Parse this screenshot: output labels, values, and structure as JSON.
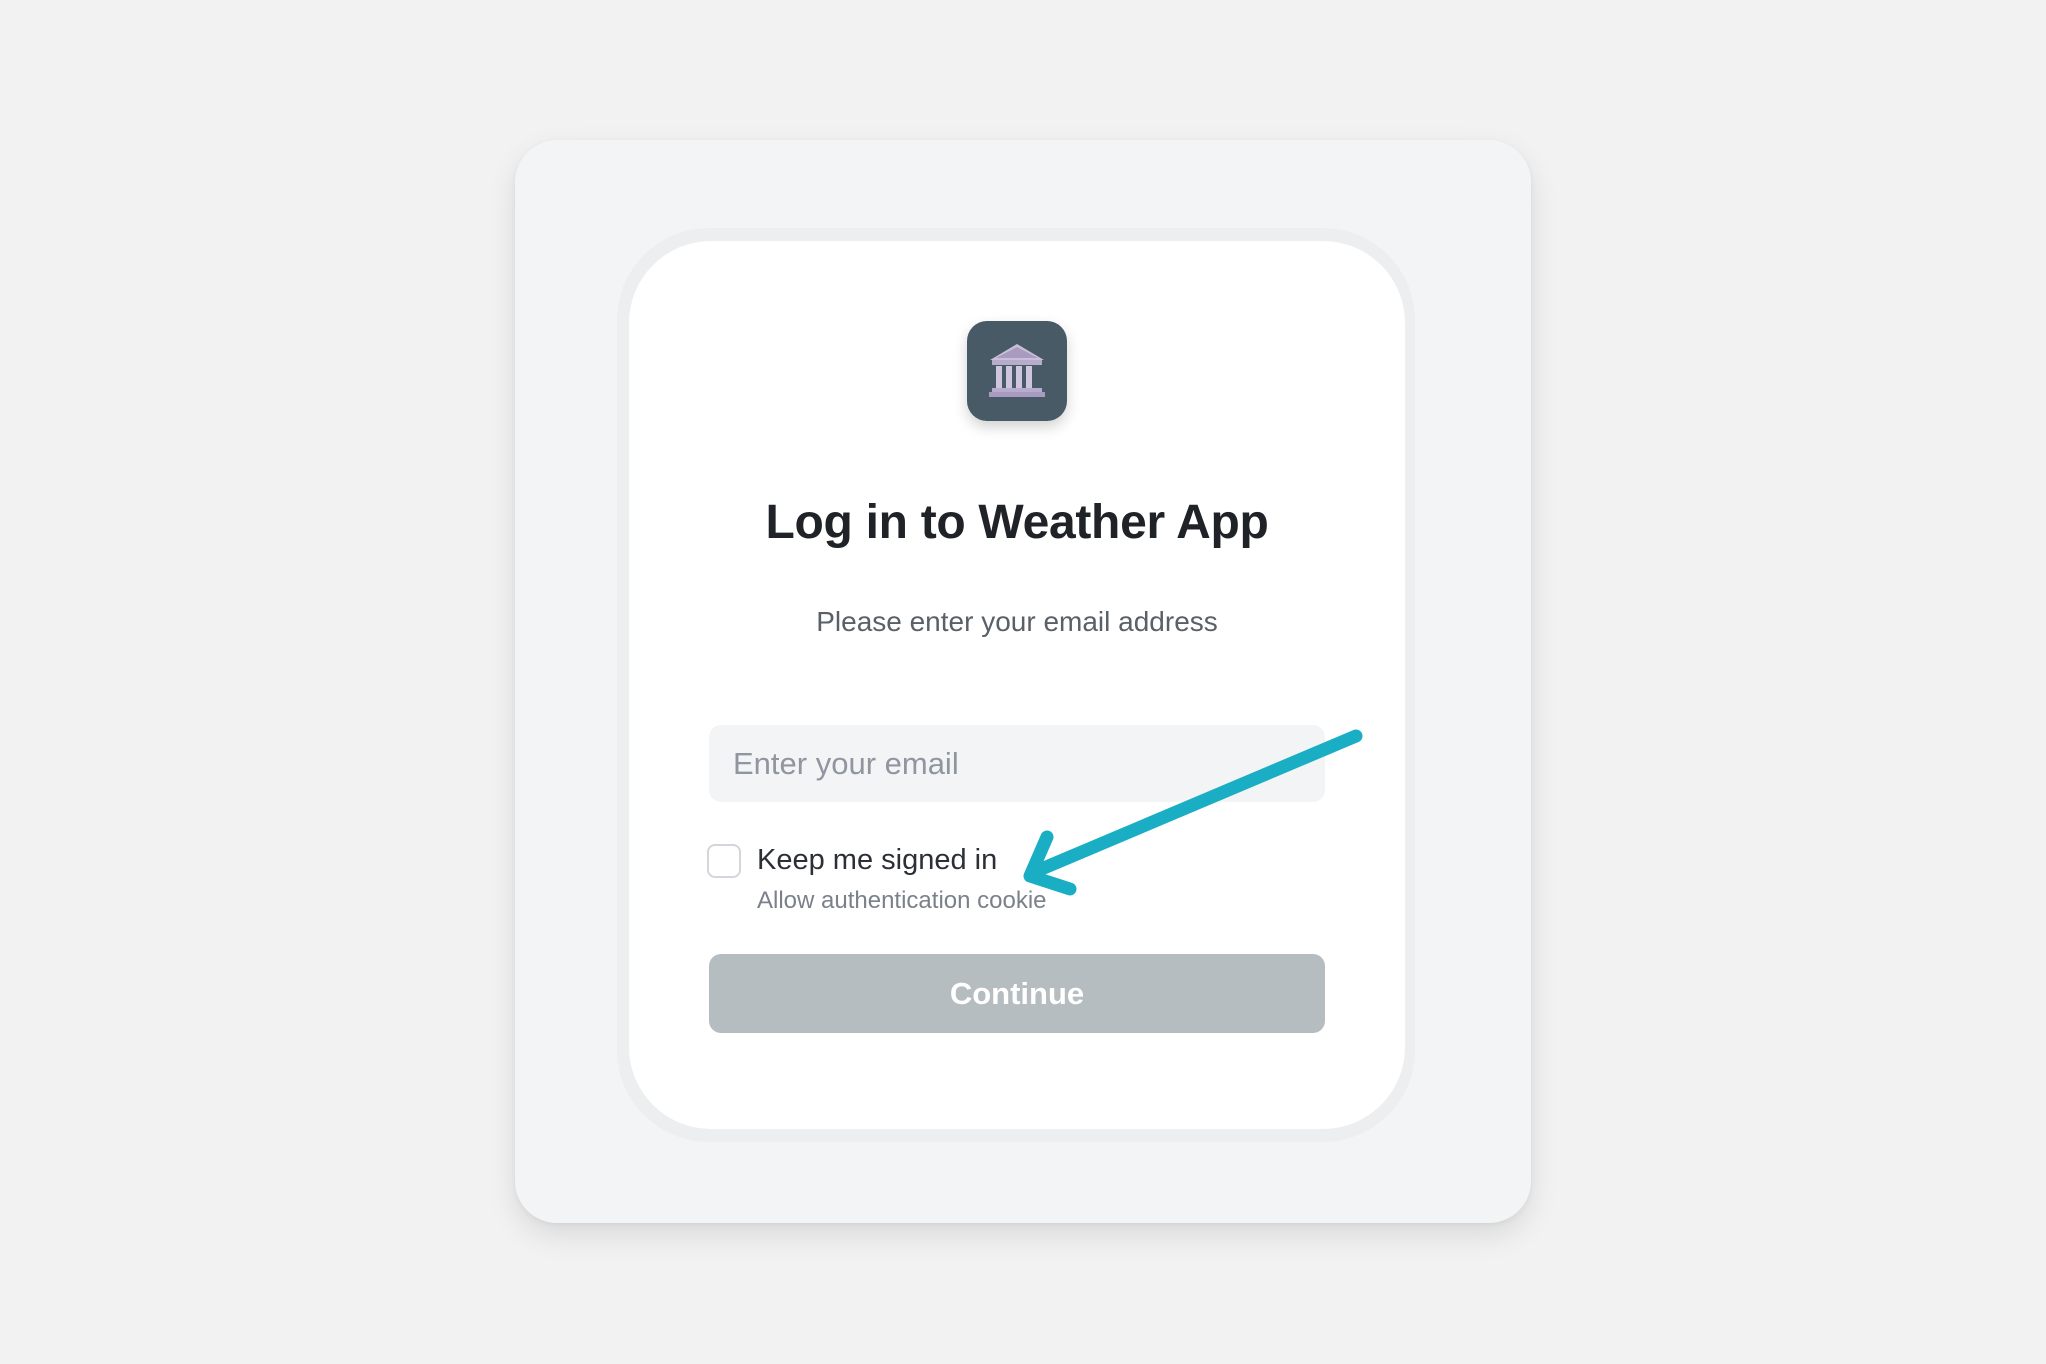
{
  "app": {
    "icon": "bank-building-icon",
    "icon_bg": "#475a66"
  },
  "login": {
    "title": "Log in to Weather App",
    "subtitle": "Please enter your email address",
    "email_placeholder": "Enter your email",
    "email_value": "",
    "keep_signed_in_label": "Keep me signed in",
    "keep_signed_in_checked": false,
    "cookie_hint": "Allow authentication cookie",
    "continue_label": "Continue",
    "continue_enabled": false
  },
  "annotation": {
    "type": "arrow",
    "color": "#19aec4",
    "points_to": "keep-me-signed-in-checkbox"
  }
}
